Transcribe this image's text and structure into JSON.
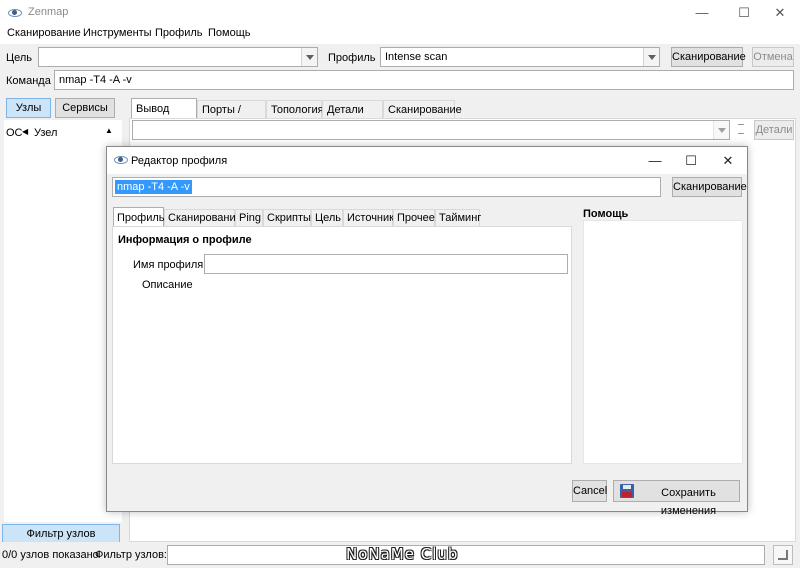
{
  "window": {
    "title": "Zenmap",
    "minimize": "—",
    "maximize": "☐",
    "close": "✕"
  },
  "menu": [
    "Сканирование",
    "Инструменты",
    "Профиль",
    "Помощь"
  ],
  "toolbar": {
    "target_label": "Цель",
    "target_value": "",
    "profile_label": "Профиль",
    "profile_value": "Intense scan",
    "scan_button": "Сканирование",
    "cancel_button": "Отмена",
    "command_label": "Команда",
    "command_value": "nmap -T4 -A -v"
  },
  "left_panel": {
    "hosts_button": "Узлы",
    "services_button": "Сервисы",
    "col_os": "ОС",
    "col_host": "Узел",
    "filter_button": "Фильтр узлов"
  },
  "main_tabs": [
    "Вывод Nmap",
    "Порты / Узлы",
    "Топология",
    "Детали узла",
    "Сканирование"
  ],
  "output": {
    "details_button": "Детали"
  },
  "dialog": {
    "title": "Редактор профиля",
    "command_value": "nmap -T4 -A -v",
    "scan_button": "Сканирование",
    "tabs": [
      "Профиль",
      "Сканирование",
      "Ping",
      "Скрипты",
      "Цель",
      "Источник",
      "Прочее",
      "Тайминг"
    ],
    "section_title": "Информация о профиле",
    "profile_name_label": "Имя профиля",
    "profile_name_value": "",
    "description_label": "Описание",
    "help_title": "Помощь",
    "cancel_button": "Cancel",
    "save_button": "Сохранить изменения"
  },
  "statusbar": {
    "shown_text": "0/0 узлов показано",
    "filter_label": "Фильтр узлов:",
    "filter_value": "",
    "watermark": "NoNaMe Club"
  },
  "colors": {
    "selection": "#3399ff",
    "toggle_active": "#cce4f7",
    "accent_border": "#7eb4ea"
  },
  "icons": [
    "zenmap-eye-icon",
    "minimize-icon",
    "maximize-icon",
    "close-icon",
    "chevron-down-icon",
    "floppy-save-icon",
    "grip-icon"
  ]
}
